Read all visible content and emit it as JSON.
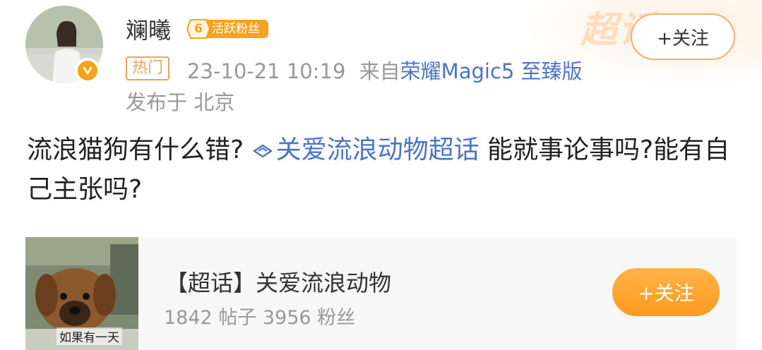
{
  "user": {
    "name": "斓曦",
    "fan_level": "6",
    "fan_label": "活跃粉丝"
  },
  "header": {
    "follow_label": "+关注",
    "watermark": "超话"
  },
  "meta": {
    "hot_tag": "热门",
    "timestamp": "23-10-21 10:19",
    "source_prefix": "来自",
    "device": "荣耀Magic5 至臻版",
    "location": "发布于 北京"
  },
  "post": {
    "text_before": "流浪猫狗有什么错?",
    "topic": "关爱流浪动物超话",
    "text_after": " 能就事论事吗?能有自己主张吗?"
  },
  "card": {
    "title": "【超话】关爱流浪动物",
    "stats": "1842 帖子 3956 粉丝",
    "follow_label": "+关注",
    "thumb_caption": "如果有一天"
  },
  "colors": {
    "accent_orange": "#f7a21c",
    "link_blue": "#4b74c4",
    "muted_gray": "#999999"
  }
}
